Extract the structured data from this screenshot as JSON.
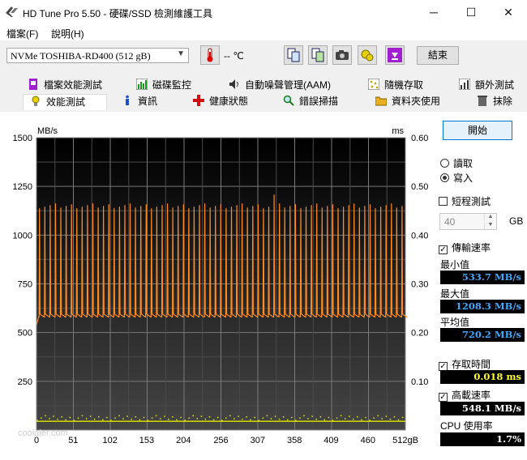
{
  "window": {
    "title": "HD Tune Pro 5.50 - 硬碟/SSD 檢測維護工具",
    "minimize": "─",
    "maximize": "☐",
    "close": "✕"
  },
  "menu": {
    "file": "檔案(F)",
    "help": "說明(H)"
  },
  "toolbar": {
    "drive": "NVMe    TOSHIBA-RD400 (512 gB)",
    "temperature": "-- ℃",
    "exit_label": "結束",
    "buttons": [
      "copy-info-icon",
      "copy-screenshot-icon",
      "camera-icon",
      "options-icon",
      "download-icon"
    ]
  },
  "tabs_row1": [
    {
      "label": "檔案效能測試",
      "icon": "file-benchmark-icon"
    },
    {
      "label": "磁碟監控",
      "icon": "disk-monitor-icon"
    },
    {
      "label": "自動噪聲管理(AAM)",
      "icon": "speaker-icon"
    },
    {
      "label": "隨機存取",
      "icon": "random-access-icon"
    },
    {
      "label": "額外測試",
      "icon": "extra-tests-icon"
    }
  ],
  "tabs_row2": [
    {
      "label": "效能測試",
      "icon": "benchmark-icon"
    },
    {
      "label": "資訊",
      "icon": "info-icon"
    },
    {
      "label": "健康狀態",
      "icon": "health-icon"
    },
    {
      "label": "錯誤掃描",
      "icon": "error-scan-icon"
    },
    {
      "label": "資料夾使用",
      "icon": "folder-usage-icon"
    },
    {
      "label": "抹除",
      "icon": "erase-icon"
    }
  ],
  "controls": {
    "start_label": "開始",
    "read_label": "讀取",
    "write_label": "寫入",
    "mode": "write",
    "short_test_label": "短程測試",
    "short_test_checked": false,
    "short_test_size": "40",
    "size_unit": "GB",
    "transfer_rate_label": "傳輸速率",
    "transfer_rate_checked": true,
    "min_label": "最小值",
    "min_value": "533.7 MB/s",
    "max_label": "最大值",
    "max_value": "1208.3 MB/s",
    "avg_label": "平均值",
    "avg_value": "720.2 MB/s",
    "access_time_label": "存取時間",
    "access_time_checked": true,
    "access_time_value": "0.018 ms",
    "burst_rate_label": "高載速率",
    "burst_rate_checked": true,
    "burst_rate_value": "548.1 MB/s",
    "cpu_label": "CPU 使用率",
    "cpu_value": "1.7%"
  },
  "chart_data": {
    "type": "line",
    "y_left_label": "MB/s",
    "y_right_label": "ms",
    "y_left_ticks": [
      "1500",
      "1250",
      "1000",
      "750",
      "500",
      "250"
    ],
    "y_right_ticks": [
      "0.60",
      "0.50",
      "0.40",
      "0.30",
      "0.20",
      "0.10"
    ],
    "x_ticks": [
      "0",
      "51",
      "102",
      "153",
      "204",
      "256",
      "307",
      "358",
      "409",
      "460",
      "512gB"
    ],
    "x_range": [
      0,
      512
    ],
    "y_left_range": [
      0,
      1500
    ],
    "y_right_range": [
      0,
      0.6
    ],
    "grid": true,
    "background_top": "#000000",
    "background_bottom": "#404040",
    "series": [
      {
        "axis": "left",
        "color": "#ff8a1e",
        "baseline": 580,
        "peak": 1150,
        "cycle_gb": 7.4,
        "start_value": 540,
        "max_value": 1208
      },
      {
        "axis": "right",
        "color": "#e6e600",
        "baseline": 0.018
      }
    ]
  },
  "watermark": "coolaler.com"
}
